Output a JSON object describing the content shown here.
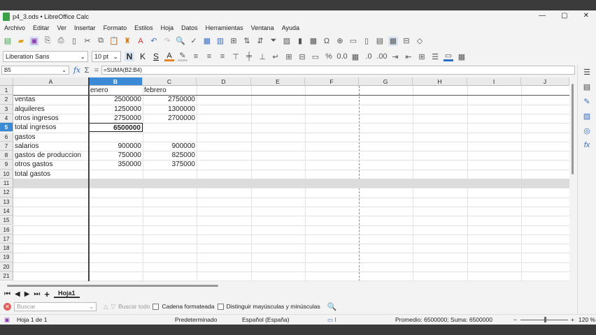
{
  "window": {
    "title": "p4_3.ods • LibreOffice Calc"
  },
  "menu": [
    "Archivo",
    "Editar",
    "Ver",
    "Insertar",
    "Formato",
    "Estilos",
    "Hoja",
    "Datos",
    "Herramientas",
    "Ventana",
    "Ayuda"
  ],
  "format": {
    "font": "Liberation Sans",
    "size": "10 pt",
    "bold": "N",
    "italic": "K",
    "underline": "S"
  },
  "formula": {
    "cell_ref": "B5",
    "content": "=SUMA(B2:B4)"
  },
  "columns": [
    "A",
    "B",
    "C",
    "D",
    "E",
    "F",
    "G",
    "H",
    "I",
    "J"
  ],
  "rows": [
    [
      "",
      "enero",
      "febrero"
    ],
    [
      "ventas",
      "2500000",
      "2750000"
    ],
    [
      "alquileres",
      "1250000",
      "1300000"
    ],
    [
      "otros ingresos",
      "2750000",
      "2700000"
    ],
    [
      "total ingresos",
      "6500000",
      ""
    ],
    [
      "gastos",
      "",
      ""
    ],
    [
      "salarios",
      "900000",
      "900000"
    ],
    [
      "gastos de produccion",
      "750000",
      "825000"
    ],
    [
      "otros gastos",
      "350000",
      "375000"
    ],
    [
      "total gastos",
      "",
      ""
    ],
    [
      "",
      "",
      ""
    ],
    [
      "",
      "",
      ""
    ],
    [
      "",
      "",
      ""
    ],
    [
      "",
      "",
      ""
    ],
    [
      "",
      "",
      ""
    ],
    [
      "",
      "",
      ""
    ],
    [
      "",
      "",
      ""
    ],
    [
      "",
      "",
      ""
    ],
    [
      "",
      "",
      ""
    ],
    [
      "",
      "",
      ""
    ],
    [
      "",
      "",
      ""
    ]
  ],
  "sheet_tab": "Hoja1",
  "find": {
    "placeholder": "Buscar",
    "find_all": "Buscar todo",
    "formatted": "Cadena formateada",
    "match_case": "Distinguir mayúsculas y minúsculas"
  },
  "status": {
    "sheet": "Hoja 1 de 1",
    "style": "Predeterminado",
    "language": "Español (España)",
    "summary": "Promedio: 6500000; Suma: 6500000",
    "zoom": "120 %"
  },
  "colors": {
    "selected_header": "#3a8ad6",
    "accent": "#2b6fc4"
  }
}
